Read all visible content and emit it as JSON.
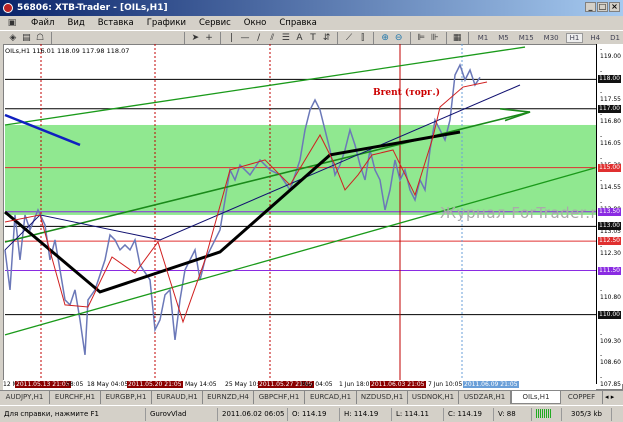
{
  "window": {
    "title": "56806: XTB-Trader - [OILs,H1]",
    "buttons": [
      "_",
      "□",
      "×"
    ]
  },
  "menu": [
    "Файл",
    "Вид",
    "Вставка",
    "Графики",
    "Сервис",
    "Окно",
    "Справка"
  ],
  "timeframes": [
    "M1",
    "M5",
    "M15",
    "M30",
    "H1",
    "H4",
    "D1"
  ],
  "active_timeframe": "H1",
  "chart": {
    "symbol_info": "OILs,H1  116.01 118.09 117.98 118.07",
    "annotation": "Brent (торг.)",
    "watermark": "Журнал ForTrader.ru",
    "price_ticks": [
      "119.00",
      "118.25",
      "117.55",
      "116.80",
      "116.05",
      "115.30",
      "114.55",
      "113.80",
      "113.05",
      "112.30",
      "110.80",
      "109.30",
      "108.60",
      "107.85"
    ],
    "levels": [
      {
        "price": "118.00",
        "color": "#000000"
      },
      {
        "price": "117.00",
        "color": "#000000"
      },
      {
        "price": "115.00",
        "color": "#e03030"
      },
      {
        "price": "113.50",
        "color": "#8a2be2"
      },
      {
        "price": "113.00",
        "color": "#000000"
      },
      {
        "price": "112.50",
        "color": "#e03030"
      },
      {
        "price": "111.50",
        "color": "#8a2be2"
      },
      {
        "price": "110.00",
        "color": "#000000"
      }
    ],
    "time_labels": [
      {
        "text": "12 May",
        "kind": "plain"
      },
      {
        "text": "2011.05.13 21:05",
        "kind": "red"
      },
      {
        "text": "08:05",
        "kind": "plain"
      },
      {
        "text": "18 May 04:05",
        "kind": "plain"
      },
      {
        "text": "2011.05.20 21:05",
        "kind": "red"
      },
      {
        "text": "May 14:05",
        "kind": "plain"
      },
      {
        "text": "25 May 10:05",
        "kind": "plain"
      },
      {
        "text": "2011.05.27 21:05",
        "kind": "red"
      },
      {
        "text": "May 04:05",
        "kind": "plain"
      },
      {
        "text": "1 Jun 18:0",
        "kind": "plain"
      },
      {
        "text": "2011.06.03 21:05",
        "kind": "red"
      },
      {
        "text": "7 Jun 10:05",
        "kind": "plain"
      },
      {
        "text": "2011.06.09 21:05",
        "kind": "blue"
      }
    ]
  },
  "chart_data": {
    "type": "line",
    "title": "OILs,H1",
    "ylim": [
      107.85,
      119.0
    ],
    "xlim": [
      0,
      119
    ],
    "price": [
      [
        1,
        112.2
      ],
      [
        2,
        110.84
      ],
      [
        3,
        113.39
      ],
      [
        4,
        111.86
      ],
      [
        5,
        113.39
      ],
      [
        6,
        112.88
      ],
      [
        7.6,
        113.56
      ],
      [
        9,
        113.05
      ],
      [
        10,
        111.86
      ],
      [
        11,
        112.54
      ],
      [
        12,
        111.52
      ],
      [
        13,
        110.5
      ],
      [
        14,
        110.33
      ],
      [
        15,
        110.84
      ],
      [
        16,
        109.82
      ],
      [
        17,
        108.63
      ],
      [
        17.6,
        110.5
      ],
      [
        19,
        110.84
      ],
      [
        20,
        111.35
      ],
      [
        21,
        111.86
      ],
      [
        22,
        112.71
      ],
      [
        23,
        112.54
      ],
      [
        24,
        112.2
      ],
      [
        25,
        112.37
      ],
      [
        26,
        112.2
      ],
      [
        27,
        112.54
      ],
      [
        28,
        111.69
      ],
      [
        30,
        111.18
      ],
      [
        31,
        109.48
      ],
      [
        32,
        109.82
      ],
      [
        33,
        110.67
      ],
      [
        34,
        110.84
      ],
      [
        35,
        109.14
      ],
      [
        36,
        110.5
      ],
      [
        37,
        111.52
      ],
      [
        39,
        112.2
      ],
      [
        40,
        111.18
      ],
      [
        41,
        111.86
      ],
      [
        42,
        112.2
      ],
      [
        43,
        112.54
      ],
      [
        44,
        112.88
      ],
      [
        45,
        113.9
      ],
      [
        46,
        114.92
      ],
      [
        47,
        114.58
      ],
      [
        48,
        115.09
      ],
      [
        50,
        114.75
      ],
      [
        52,
        115.26
      ],
      [
        54,
        114.92
      ],
      [
        56,
        114.75
      ],
      [
        58,
        114.24
      ],
      [
        60,
        115.26
      ],
      [
        61,
        116.28
      ],
      [
        62,
        116.96
      ],
      [
        63,
        117.3
      ],
      [
        64,
        116.96
      ],
      [
        65,
        116.28
      ],
      [
        66,
        115.6
      ],
      [
        67,
        114.75
      ],
      [
        68,
        115.09
      ],
      [
        69,
        115.6
      ],
      [
        70,
        116.28
      ],
      [
        71,
        115.77
      ],
      [
        72,
        115.09
      ],
      [
        73,
        114.58
      ],
      [
        74,
        115.6
      ],
      [
        75,
        114.92
      ],
      [
        76,
        114.58
      ],
      [
        77,
        113.56
      ],
      [
        78,
        114.24
      ],
      [
        79,
        115.26
      ],
      [
        80,
        114.58
      ],
      [
        81,
        114.92
      ],
      [
        82,
        114.24
      ],
      [
        83,
        113.9
      ],
      [
        84,
        114.58
      ],
      [
        85,
        114.24
      ],
      [
        86,
        115.6
      ],
      [
        87,
        116.62
      ],
      [
        88,
        116.28
      ],
      [
        89,
        115.94
      ],
      [
        90,
        116.62
      ],
      [
        91,
        118.15
      ],
      [
        92,
        118.49
      ],
      [
        93,
        117.98
      ],
      [
        94,
        118.32
      ],
      [
        95,
        117.81
      ],
      [
        96,
        118.07
      ]
    ],
    "green_zone": [
      113.39,
      116.45
    ],
    "trendlines": [
      {
        "name": "channel-upper",
        "color": "#1a9a1a",
        "w": 1.3,
        "pts": [
          [
            1,
            116.45
          ],
          [
            105,
            119.1
          ]
        ]
      },
      {
        "name": "channel-lower",
        "color": "#1a9a1a",
        "w": 1.3,
        "pts": [
          [
            1,
            109.31
          ],
          [
            119,
            114.99
          ]
        ]
      },
      {
        "name": "channel-middle",
        "color": "#1a8a1a",
        "w": 1.6,
        "pts": [
          [
            1,
            112.47
          ],
          [
            106,
            116.89
          ]
        ]
      },
      {
        "name": "blue-thick",
        "color": "#1020c0",
        "w": 2.5,
        "pts": [
          [
            1,
            116.79
          ],
          [
            16,
            115.77
          ]
        ]
      },
      {
        "name": "navy-line",
        "color": "#101070",
        "w": 1,
        "pts": [
          [
            1,
            112.2
          ],
          [
            8,
            113.39
          ],
          [
            32,
            112.54
          ],
          [
            104,
            117.81
          ]
        ]
      },
      {
        "name": "black-thick",
        "color": "#000000",
        "w": 3,
        "pts": [
          [
            1,
            113.49
          ],
          [
            20,
            110.77
          ],
          [
            44,
            112.13
          ],
          [
            66,
            115.43
          ],
          [
            92,
            116.21
          ]
        ]
      },
      {
        "name": "red-zigzag",
        "color": "#d02020",
        "w": 1,
        "pts": [
          [
            1,
            113.15
          ],
          [
            8,
            113.39
          ],
          [
            13,
            110.33
          ],
          [
            17.6,
            110.26
          ],
          [
            22.4,
            111.96
          ],
          [
            27,
            111.41
          ],
          [
            31.6,
            112.47
          ],
          [
            36.6,
            109.75
          ],
          [
            41,
            111.86
          ],
          [
            46,
            114.92
          ],
          [
            53,
            115.26
          ],
          [
            58,
            114.41
          ],
          [
            64,
            116.11
          ],
          [
            67,
            115.09
          ],
          [
            69,
            114.24
          ],
          [
            71.6,
            114.75
          ],
          [
            74.4,
            115.43
          ],
          [
            78.6,
            115.6
          ],
          [
            83,
            114.07
          ],
          [
            86.6,
            116.04
          ],
          [
            88,
            117.06
          ],
          [
            92.6,
            117.74
          ],
          [
            97.4,
            117.91
          ]
        ]
      }
    ],
    "vlines": [
      {
        "x": 8.2,
        "color": "#c00000",
        "dash": true
      },
      {
        "x": 31,
        "color": "#c00000",
        "dash": true
      },
      {
        "x": 54,
        "color": "#c00000",
        "dash": true
      },
      {
        "x": 80,
        "color": "#c00000",
        "dash": false
      },
      {
        "x": 92.4,
        "color": "#6a9fd8",
        "dash": true
      }
    ]
  },
  "tabs": [
    "AUDJPY,H1",
    "EURCHF,H1",
    "EURGBP,H1",
    "EURAUD,H1",
    "EURNZD,H4",
    "GBPCHF,H1",
    "EURCAD,H1",
    "NZDUSD,H1",
    "USDNOK,H1",
    "USDZAR,H1",
    "OILs,H1",
    "COPPEF"
  ],
  "active_tab": "OILs,H1",
  "status": {
    "help": "Для справки, нажмите F1",
    "profile": "GurovVlad",
    "datetime": "2011.06.02 06:05",
    "open": "O: 114.19",
    "high": "H: 114.19",
    "low": "L: 114.11",
    "close": "C: 114.19",
    "volume": "V: 88",
    "traffic": "305/3 kb"
  }
}
